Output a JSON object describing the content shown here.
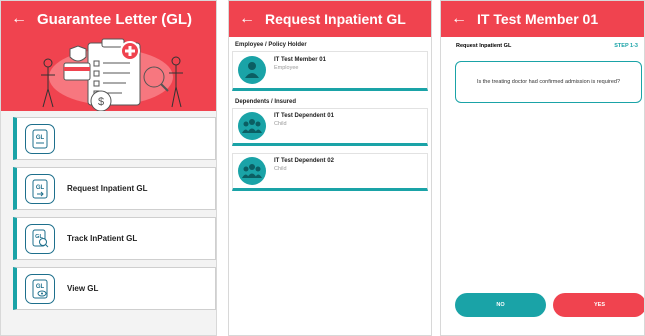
{
  "colors": {
    "brand_red": "#f0434f",
    "teal": "#1aa3a7"
  },
  "panel1": {
    "title": "Guarantee Letter (GL)",
    "menu": [
      {
        "label": "",
        "icon": "gl-document-icon"
      },
      {
        "label": "Request Inpatient GL",
        "icon": "gl-request-icon"
      },
      {
        "label": "Track InPatient GL",
        "icon": "gl-track-icon"
      },
      {
        "label": "View GL",
        "icon": "gl-view-icon"
      }
    ]
  },
  "panel2": {
    "title": "Request Inpatient GL",
    "section_employee": "Employee / Policy Holder",
    "section_dependents": "Dependents / Insured",
    "employee": {
      "name": "IT Test Member 01",
      "role": "Employee"
    },
    "dependents": [
      {
        "name": "IT Test Dependent 01",
        "role": "Child"
      },
      {
        "name": "IT Test Dependent 02",
        "role": "Child"
      }
    ]
  },
  "panel3": {
    "title": "IT Test Member 01",
    "subtitle": "Request Inpatient GL",
    "step": "STEP 1-3",
    "question": "Is the treating doctor had confirmed admission is required?",
    "no_label": "NO",
    "yes_label": "YES"
  }
}
